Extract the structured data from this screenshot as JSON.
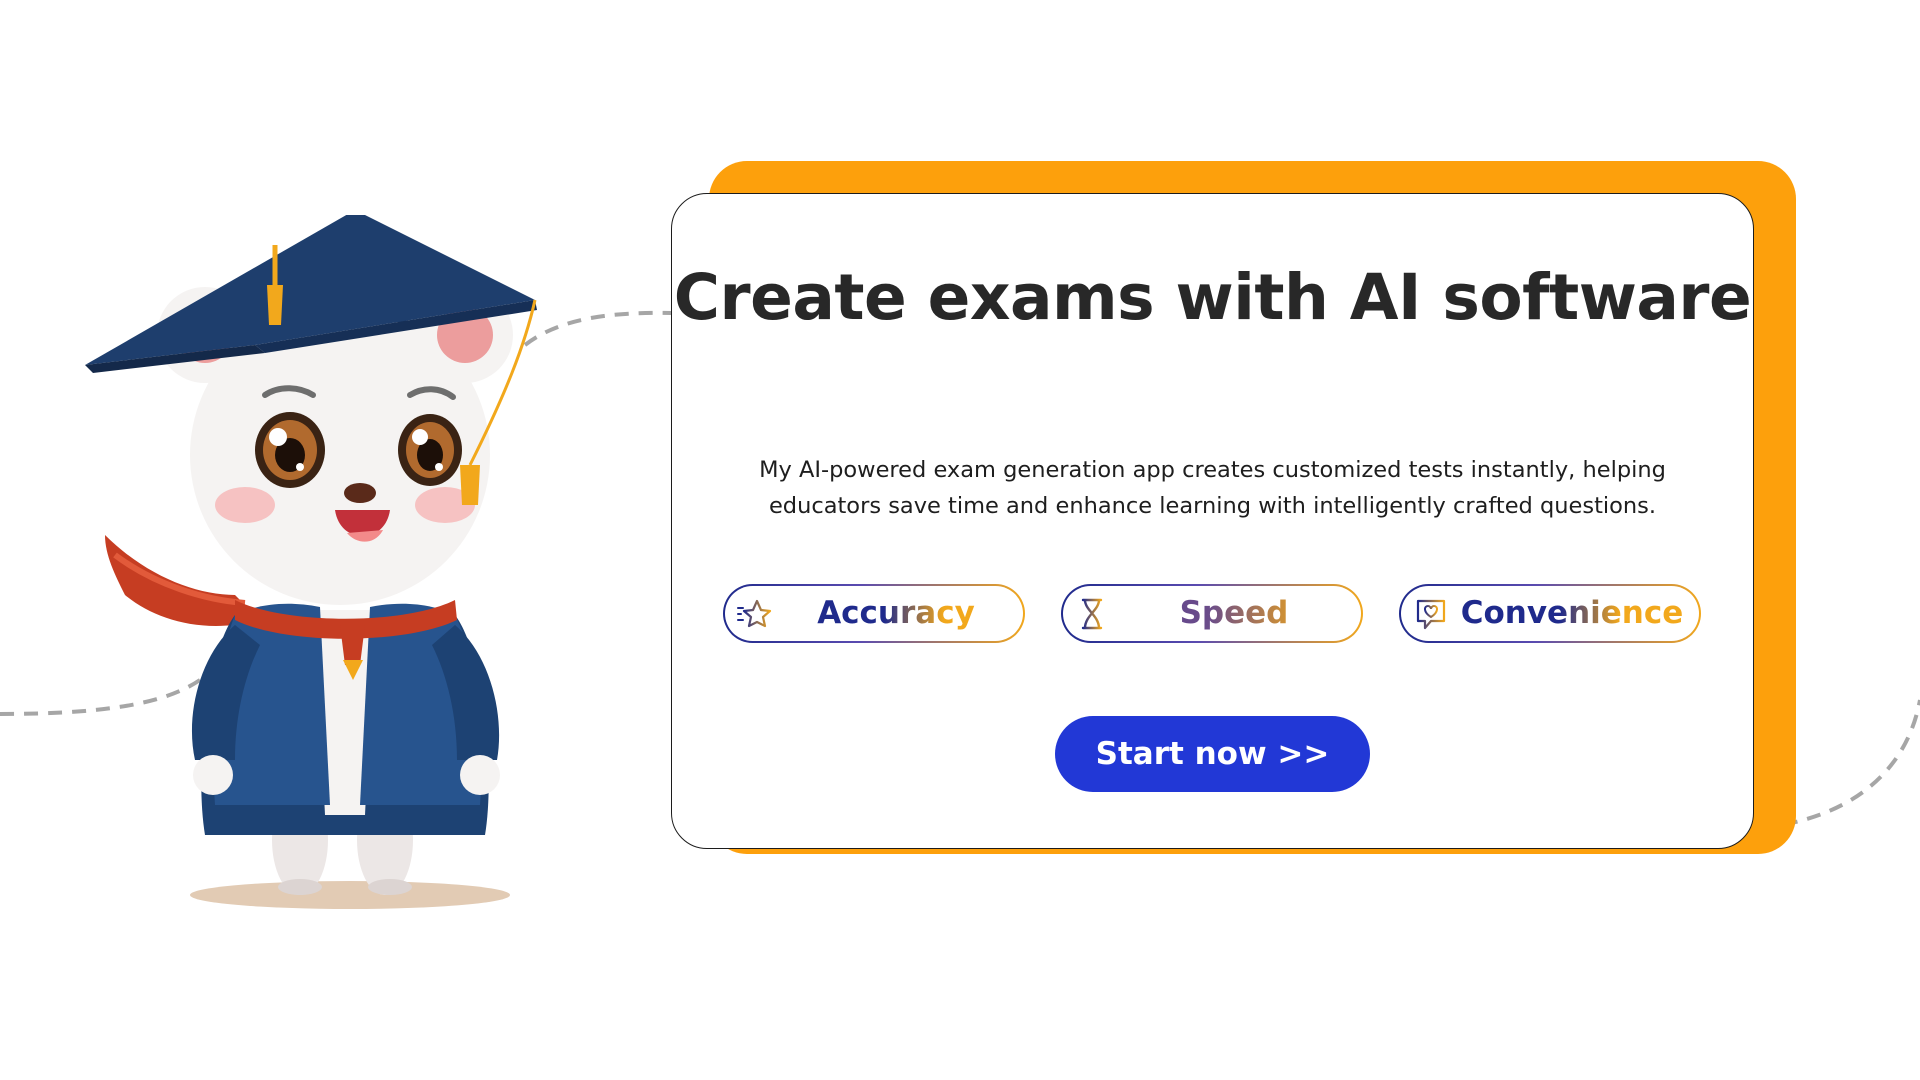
{
  "hero": {
    "title": "Create exams with AI software",
    "description": "My AI-powered exam generation app creates customized tests instantly, helping educators save time and enhance learning with intelligently crafted questions.",
    "features": [
      {
        "label": "Accuracy",
        "icon": "star-icon"
      },
      {
        "label": "Speed",
        "icon": "hourglass-icon"
      },
      {
        "label": "Convenience",
        "icon": "heart-chat-icon"
      }
    ],
    "cta_label": "Start now >>"
  },
  "mascot": {
    "icon": "graduate-bear-mascot"
  },
  "colors": {
    "accent_orange": "#fda00c",
    "cta_blue": "#2238d6",
    "navy": "#1f2a8c",
    "gold": "#f2a81c",
    "title_text": "#282828"
  }
}
